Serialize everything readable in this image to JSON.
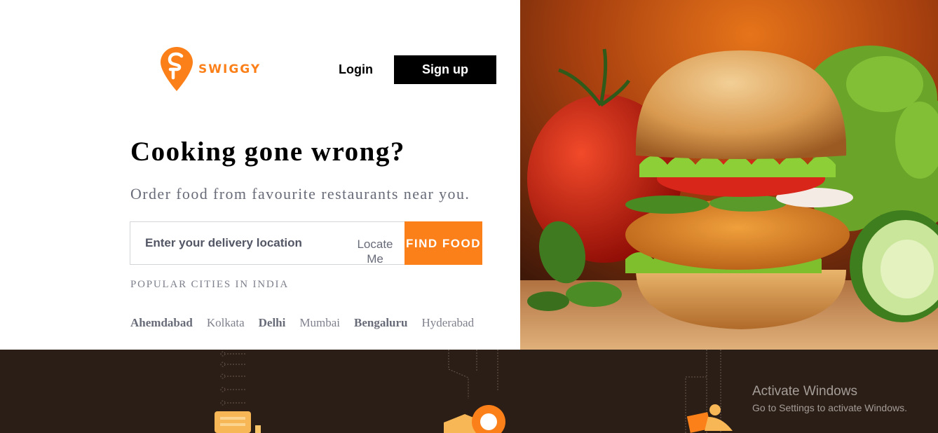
{
  "brand": {
    "name": "SWIGGY",
    "color": "#fc8019"
  },
  "header": {
    "login_label": "Login",
    "signup_label": "Sign up"
  },
  "hero": {
    "title": "Cooking gone wrong?",
    "subtitle": "Order food from favourite restaurants near you."
  },
  "search": {
    "placeholder": "Enter your delivery location",
    "value": "",
    "locate_label": "Locate Me",
    "find_label": "FIND FOOD"
  },
  "cities": {
    "title": "POPULAR CITIES IN INDIA",
    "items": [
      {
        "name": "Ahemdabad",
        "bold": true
      },
      {
        "name": "Kolkata",
        "bold": false
      },
      {
        "name": "Delhi",
        "bold": true
      },
      {
        "name": "Mumbai",
        "bold": false
      },
      {
        "name": "Bengaluru",
        "bold": true
      },
      {
        "name": "Hyderabad",
        "bold": false
      }
    ]
  },
  "bottom_icons": [
    "order-menu-icon",
    "food-box-pin-icon",
    "delivery-scooter-icon"
  ],
  "watermark": {
    "title": "Activate Windows",
    "subtitle": "Go to Settings to activate Windows."
  },
  "colors": {
    "accent": "#fc8019",
    "dark_band": "#2b1e16",
    "text_gray": "#686b78"
  }
}
